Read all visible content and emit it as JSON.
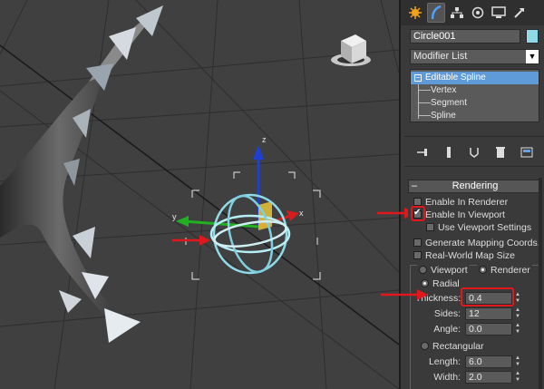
{
  "viewport": {
    "axis_x_label": "x",
    "axis_y_label": "y",
    "axis_z_label": "z"
  },
  "tabs": [
    "create-icon",
    "modify-icon",
    "hierarchy-icon",
    "motion-icon",
    "display-icon",
    "utilities-icon"
  ],
  "object": {
    "name": "Circle001",
    "color": "#8fd9e8"
  },
  "modifier_list": {
    "label": "Modifier List"
  },
  "stack": {
    "root": "Editable Spline",
    "children": [
      "Vertex",
      "Segment",
      "Spline"
    ]
  },
  "rendering": {
    "title": "Rendering",
    "collapse_symbol": "–",
    "enable_in_renderer": "Enable In Renderer",
    "enable_in_viewport": "Enable In Viewport",
    "use_viewport_settings": "Use Viewport Settings",
    "generate_mapping": "Generate Mapping Coords.",
    "real_world_map": "Real-World Map Size",
    "viewport_opt": "Viewport",
    "renderer_opt": "Renderer",
    "radial": "Radial",
    "thickness_label": "Thickness:",
    "thickness_value": "0.4",
    "sides_label": "Sides:",
    "sides_value": "12",
    "angle_label": "Angle:",
    "angle_value": "0.0",
    "rectangular": "Rectangular",
    "length_label": "Length:",
    "length_value": "6.0",
    "width_label": "Width:",
    "width_value": "2.0"
  },
  "colors": {
    "highlight": "#e0171c",
    "selection": "#5f9bd9"
  }
}
